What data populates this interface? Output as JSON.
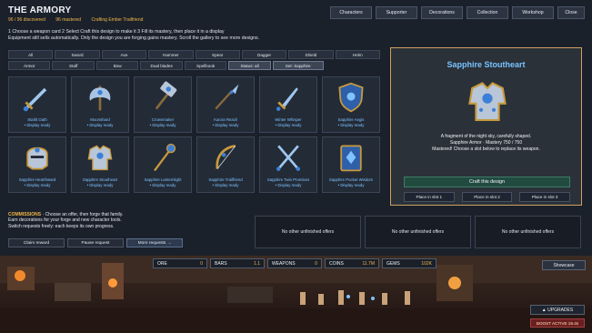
{
  "header": {
    "title": "THE ARMORY",
    "discovered": "96 / 96 discovered",
    "mastered": "96 mastered",
    "crafting": "Crafting Ember Trailfriend"
  },
  "nav": [
    "Characters",
    "Supporter",
    "Decorations",
    "Collection",
    "Workshop",
    "Close"
  ],
  "instructions": [
    "1   Choose a weapon card    2   Select Craft this design to make it    3   Fill its mastery, then place it in a display",
    "Equipment still sells automatically. Only the design you are forging gains mastery. Scroll the gallery to see more designs."
  ],
  "filters": {
    "row1": [
      "All",
      "Sword",
      "Axe",
      "Hammer",
      "Spear",
      "Dagger",
      "Shield",
      "Helm"
    ],
    "row2": [
      "Armor",
      "Staff",
      "Bow",
      "Dual blades",
      "Spellbook",
      "Status: all",
      "Set: Sapphire"
    ]
  },
  "cards": [
    {
      "name": "Starlit Oath",
      "status": "• Display ready",
      "icon": "sword-icon"
    },
    {
      "name": "Moonshard",
      "status": "• Display ready",
      "icon": "axe-icon"
    },
    {
      "name": "Crownmaker",
      "status": "• Display ready",
      "icon": "hammer-icon"
    },
    {
      "name": "Aurora Reach",
      "status": "• Display ready",
      "icon": "spear-icon"
    },
    {
      "name": "Winter Whisper",
      "status": "• Display ready",
      "icon": "dagger-icon"
    },
    {
      "name": "Sapphire Aegis",
      "status": "• Display ready",
      "icon": "shield-icon"
    },
    {
      "name": "Sapphire Hearthward",
      "status": "• Display ready",
      "icon": "helm-icon"
    },
    {
      "name": "Sapphire Stoutheart",
      "status": "• Display ready",
      "icon": "armor-icon"
    },
    {
      "name": "Sapphire Lanternlight",
      "status": "• Display ready",
      "icon": "staff-icon"
    },
    {
      "name": "Sapphire Trailfriend",
      "status": "• Display ready",
      "icon": "bow-icon"
    },
    {
      "name": "Sapphire Twin Promises",
      "status": "• Display ready",
      "icon": "dual-blades-icon"
    },
    {
      "name": "Sapphire Pocket Wisdom",
      "status": "• Display ready",
      "icon": "spellbook-icon"
    }
  ],
  "detail": {
    "title": "Sapphire Stoutheart",
    "line1": "A fragment of the night sky, carefully shaped.",
    "line2": "Sapphire Armor · Mastery 750 / 750",
    "line3": "Mastered! Choose a slot below to replace its weapon.",
    "craft": "Craft this design",
    "slots": [
      "Place in slot 1",
      "Place in slot 2",
      "Place in slot 3"
    ]
  },
  "commissions": {
    "label": "COMMISSIONS",
    "text1": " · Choose an offer, then forge that family.",
    "text2": "Earn decorations for your forge and new character tools.",
    "text3": "Switch requests freely: each keeps its own progress.",
    "buttons": [
      "Claim reward",
      "Pause request",
      "More requests →"
    ],
    "offers": [
      "No other unfinished offers",
      "No other unfinished offers",
      "No other unfinished offers"
    ]
  },
  "resources": [
    {
      "label": "ORE",
      "value": "0"
    },
    {
      "label": "BARS",
      "value": "1.1"
    },
    {
      "label": "WEAPONS",
      "value": "0"
    },
    {
      "label": "COINS",
      "value": "11.7M"
    },
    {
      "label": "GEMS",
      "value": "102K"
    }
  ],
  "scene": {
    "showcase": "Showcase",
    "upgrades": "▲ UPGRADES",
    "boost": "BOOST ACTIVE  19.4s"
  }
}
